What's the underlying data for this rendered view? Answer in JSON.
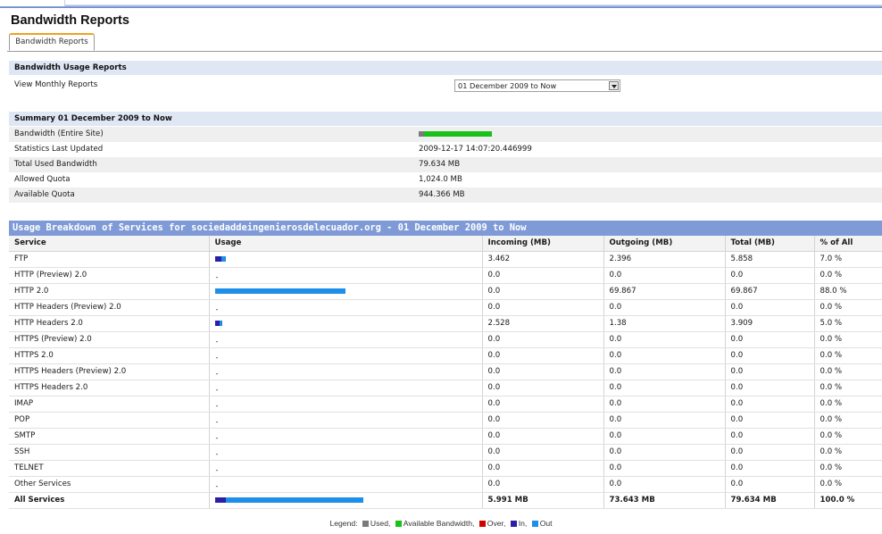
{
  "page": {
    "title": "Bandwidth Reports",
    "tab_label": "Bandwidth Reports"
  },
  "colors": {
    "used": "#7a7a7a",
    "available": "#19c219",
    "over": "#d40000",
    "in": "#2a1fa8",
    "out": "#1e8fe8",
    "section_header": "#7f9ad6"
  },
  "usage_reports": {
    "header": "Bandwidth Usage Reports",
    "monthly_label": "View Monthly Reports",
    "selected_period": "01 December 2009 to Now"
  },
  "summary": {
    "header": "Summary 01 December 2009 to Now",
    "bandwidth_label": "Bandwidth (Entire Site)",
    "bandwidth_used_fraction": 0.0778,
    "updated_label": "Statistics Last Updated",
    "updated_value": "2009-12-17 14:07:20.446999",
    "total_label": "Total Used Bandwidth",
    "total_value": "79.634 MB",
    "allowed_label": "Allowed Quota",
    "allowed_value": "1,024.0 MB",
    "available_label": "Available Quota",
    "available_value": "944.366 MB"
  },
  "breakdown": {
    "title": "Usage Breakdown of Services for sociedaddeingenierosdelecuador.org - 01 December 2009 to Now",
    "columns": [
      "Service",
      "Usage",
      "Incoming (MB)",
      "Outgoing (MB)",
      "Total (MB)",
      "% of All"
    ],
    "rows": [
      {
        "service": "FTP",
        "in_mb": 3.462,
        "out_mb": 2.396,
        "incoming": "3.462",
        "outgoing": "2.396",
        "total": "5.858",
        "pct": "7.0 %"
      },
      {
        "service": "HTTP (Preview) 2.0",
        "in_mb": 0,
        "out_mb": 0,
        "incoming": "0.0",
        "outgoing": "0.0",
        "total": "0.0",
        "pct": "0.0 %"
      },
      {
        "service": "HTTP 2.0",
        "in_mb": 0,
        "out_mb": 69.867,
        "incoming": "0.0",
        "outgoing": "69.867",
        "total": "69.867",
        "pct": "88.0 %"
      },
      {
        "service": "HTTP Headers (Preview) 2.0",
        "in_mb": 0,
        "out_mb": 0,
        "incoming": "0.0",
        "outgoing": "0.0",
        "total": "0.0",
        "pct": "0.0 %"
      },
      {
        "service": "HTTP Headers 2.0",
        "in_mb": 2.528,
        "out_mb": 1.38,
        "incoming": "2.528",
        "outgoing": "1.38",
        "total": "3.909",
        "pct": "5.0 %"
      },
      {
        "service": "HTTPS (Preview) 2.0",
        "in_mb": 0,
        "out_mb": 0,
        "incoming": "0.0",
        "outgoing": "0.0",
        "total": "0.0",
        "pct": "0.0 %"
      },
      {
        "service": "HTTPS 2.0",
        "in_mb": 0,
        "out_mb": 0,
        "incoming": "0.0",
        "outgoing": "0.0",
        "total": "0.0",
        "pct": "0.0 %"
      },
      {
        "service": "HTTPS Headers (Preview) 2.0",
        "in_mb": 0,
        "out_mb": 0,
        "incoming": "0.0",
        "outgoing": "0.0",
        "total": "0.0",
        "pct": "0.0 %"
      },
      {
        "service": "HTTPS Headers 2.0",
        "in_mb": 0,
        "out_mb": 0,
        "incoming": "0.0",
        "outgoing": "0.0",
        "total": "0.0",
        "pct": "0.0 %"
      },
      {
        "service": "IMAP",
        "in_mb": 0,
        "out_mb": 0,
        "incoming": "0.0",
        "outgoing": "0.0",
        "total": "0.0",
        "pct": "0.0 %"
      },
      {
        "service": "POP",
        "in_mb": 0,
        "out_mb": 0,
        "incoming": "0.0",
        "outgoing": "0.0",
        "total": "0.0",
        "pct": "0.0 %"
      },
      {
        "service": "SMTP",
        "in_mb": 0,
        "out_mb": 0,
        "incoming": "0.0",
        "outgoing": "0.0",
        "total": "0.0",
        "pct": "0.0 %"
      },
      {
        "service": "SSH",
        "in_mb": 0,
        "out_mb": 0,
        "incoming": "0.0",
        "outgoing": "0.0",
        "total": "0.0",
        "pct": "0.0 %"
      },
      {
        "service": "TELNET",
        "in_mb": 0,
        "out_mb": 0,
        "incoming": "0.0",
        "outgoing": "0.0",
        "total": "0.0",
        "pct": "0.0 %"
      },
      {
        "service": "Other Services",
        "in_mb": 0,
        "out_mb": 0,
        "incoming": "0.0",
        "outgoing": "0.0",
        "total": "0.0",
        "pct": "0.0 %"
      }
    ],
    "total_row": {
      "service": "All Services",
      "in_mb": 5.991,
      "out_mb": 73.643,
      "incoming": "5.991 MB",
      "outgoing": "73.643 MB",
      "total": "79.634 MB",
      "pct": "100.0 %"
    },
    "empty_marker": "-"
  },
  "legend": {
    "prefix": "Legend:",
    "used": "Used,",
    "available": "Available Bandwidth,",
    "over": "Over,",
    "in": "In,",
    "out": "Out"
  }
}
